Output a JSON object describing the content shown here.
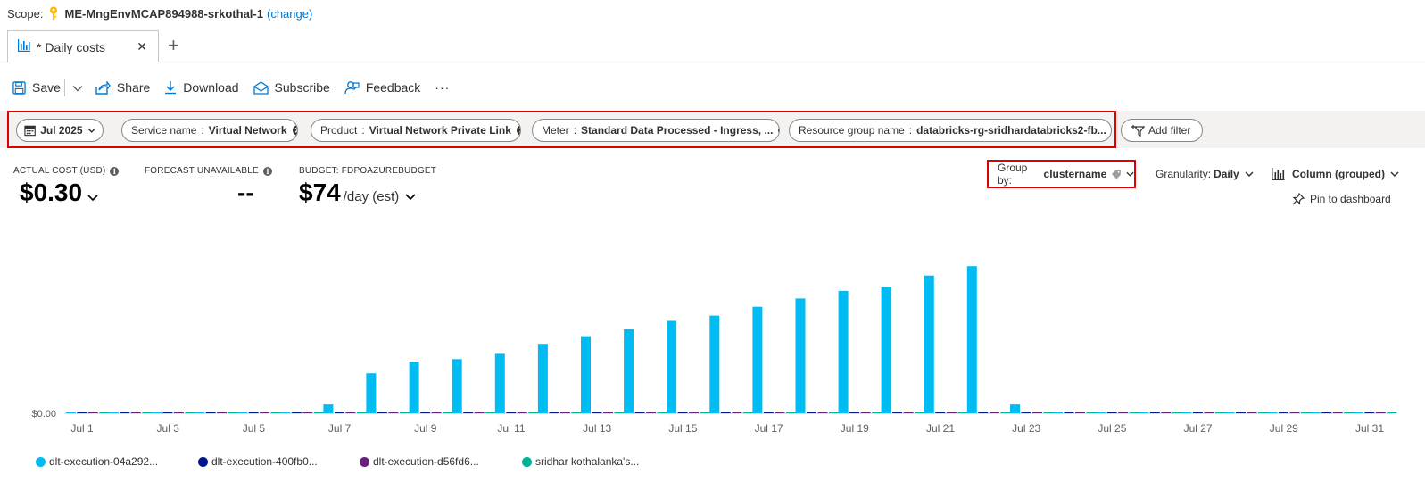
{
  "scope": {
    "label": "Scope:",
    "name": "ME-MngEnvMCAP894988-srkothal-1",
    "change_link": "(change)"
  },
  "tab": {
    "label": "* Daily costs",
    "close": "✕",
    "add": "+"
  },
  "toolbar": {
    "save": "Save",
    "share": "Share",
    "download": "Download",
    "subscribe": "Subscribe",
    "feedback": "Feedback",
    "more": "···"
  },
  "filters": {
    "date": "Jul 2025",
    "service": {
      "key": "Service name",
      "value": "Virtual Network"
    },
    "product": {
      "key": "Product",
      "value": "Virtual Network Private Link"
    },
    "meter": {
      "key": "Meter",
      "value": "Standard Data Processed - Ingress, ..."
    },
    "resource_group": {
      "key": "Resource group name",
      "value": "databricks-rg-sridhardatabricks2-fb..."
    },
    "add_filter": "Add filter",
    "sep": ":"
  },
  "metrics": {
    "actual_label": "ACTUAL COST (USD)",
    "actual_value": "$0.30",
    "forecast_label": "FORECAST UNAVAILABLE",
    "forecast_value": "--",
    "budget_label": "BUDGET: FDPOAZUREBUDGET",
    "budget_value": "$74",
    "budget_suffix": "/day (est)"
  },
  "controls": {
    "groupby_label": "Group by:",
    "groupby_value": "clustername",
    "granularity_label": "Granularity:",
    "granularity_value": "Daily",
    "chart_type": "Column (grouped)",
    "pin": "Pin to dashboard"
  },
  "colors": {
    "series1": "#00bcf2",
    "series2": "#00188f",
    "series3": "#68217a",
    "series4": "#00b294",
    "accent": "#0078d4",
    "highlight": "#e00000"
  },
  "chart_data": {
    "type": "bar",
    "ylabel": "",
    "y_tick_label": "$0.00",
    "categories": [
      "Jul 1",
      "Jul 2",
      "Jul 3",
      "Jul 4",
      "Jul 5",
      "Jul 6",
      "Jul 7",
      "Jul 8",
      "Jul 9",
      "Jul 10",
      "Jul 11",
      "Jul 12",
      "Jul 13",
      "Jul 14",
      "Jul 15",
      "Jul 16",
      "Jul 17",
      "Jul 18",
      "Jul 19",
      "Jul 20",
      "Jul 21",
      "Jul 22",
      "Jul 23",
      "Jul 24",
      "Jul 25",
      "Jul 26",
      "Jul 27",
      "Jul 28",
      "Jul 29",
      "Jul 30",
      "Jul 31"
    ],
    "x_tick_labels": [
      "Jul 1",
      "Jul 3",
      "Jul 5",
      "Jul 7",
      "Jul 9",
      "Jul 11",
      "Jul 13",
      "Jul 15",
      "Jul 17",
      "Jul 19",
      "Jul 21",
      "Jul 23",
      "Jul 25",
      "Jul 27",
      "Jul 29",
      "Jul 31"
    ],
    "series": [
      {
        "name": "dlt-execution-04a292...",
        "values": [
          0,
          0,
          0,
          0,
          0,
          0,
          0.0015,
          0.0068,
          0.0088,
          0.0092,
          0.0101,
          0.0118,
          0.0131,
          0.0143,
          0.0157,
          0.0166,
          0.0181,
          0.0195,
          0.0208,
          0.0214,
          0.0234,
          0.025,
          0.0015,
          0,
          0,
          0,
          0,
          0,
          0,
          0,
          0
        ]
      },
      {
        "name": "dlt-execution-400fb0...",
        "values": [
          0,
          0,
          0,
          0,
          0,
          0,
          0,
          0,
          0,
          0,
          0,
          0,
          0,
          0,
          0,
          0,
          0,
          0,
          0,
          0,
          0,
          0,
          0,
          0,
          0,
          0,
          0,
          0,
          0,
          0,
          0.0002
        ]
      },
      {
        "name": "dlt-execution-d56fd6...",
        "values": [
          0,
          0,
          0,
          0,
          0,
          0,
          0,
          0,
          0,
          0,
          0,
          0,
          0,
          0,
          0,
          0,
          0,
          0,
          0,
          0,
          0,
          0,
          0,
          0,
          0,
          0,
          0,
          0,
          0,
          0,
          0
        ]
      },
      {
        "name": "sridhar kothalanka's...",
        "values": [
          0,
          0,
          0,
          0,
          0,
          0,
          0,
          0,
          0,
          0,
          0,
          0,
          0,
          0,
          0,
          0,
          0,
          0,
          0,
          0,
          0,
          0,
          0,
          0,
          0,
          0,
          0,
          0,
          0,
          0,
          0
        ]
      }
    ],
    "ylim": [
      0,
      0.027
    ],
    "legend": "bottom-left",
    "grid": false
  }
}
